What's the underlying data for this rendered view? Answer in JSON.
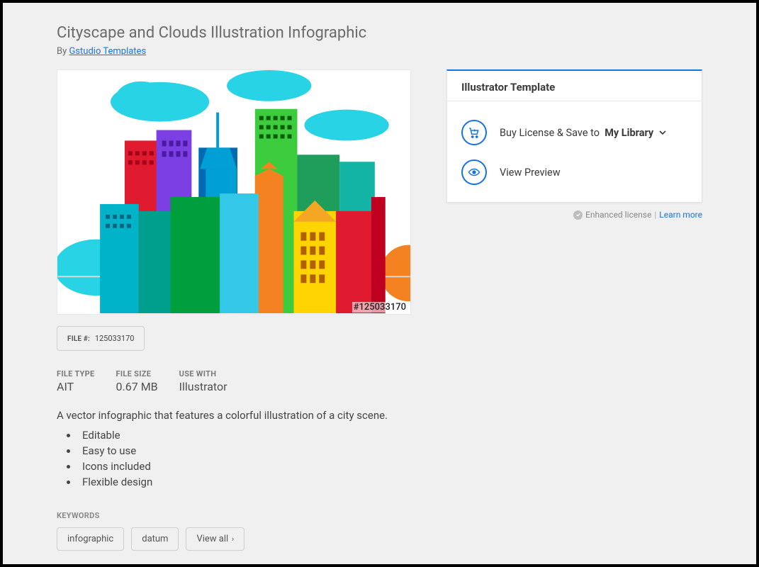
{
  "title": "Cityscape and Clouds Illustration Infographic",
  "byline_prefix": "By ",
  "author": "Gstudio Templates",
  "watermark": "#125033170",
  "file_label": "FILE #:",
  "file_number": "125033170",
  "meta": {
    "file_type_label": "FILE TYPE",
    "file_type": "AIT",
    "file_size_label": "FILE SIZE",
    "file_size": "0.67 MB",
    "use_with_label": "USE WITH",
    "use_with": "Illustrator"
  },
  "description": "A vector infographic that features a colorful illustration of a city scene.",
  "features": [
    "Editable",
    "Easy to use",
    "Icons included",
    "Flexible design"
  ],
  "keywords_label": "KEYWORDS",
  "keywords": [
    "infographic",
    "datum"
  ],
  "view_all": "View all",
  "panel": {
    "header": "Illustrator Template",
    "buy_text": "Buy License & Save to",
    "library": "My Library",
    "preview": "View Preview"
  },
  "license": {
    "enhanced": "Enhanced license",
    "sep": "|",
    "learn": "Learn more"
  }
}
